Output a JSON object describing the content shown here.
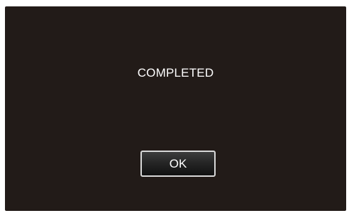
{
  "dialog": {
    "message": "COMPLETED",
    "ok_label": "OK"
  },
  "colors": {
    "screen_background": "#221b18",
    "text": "#ffffff",
    "button_border": "#d8d8d8"
  }
}
